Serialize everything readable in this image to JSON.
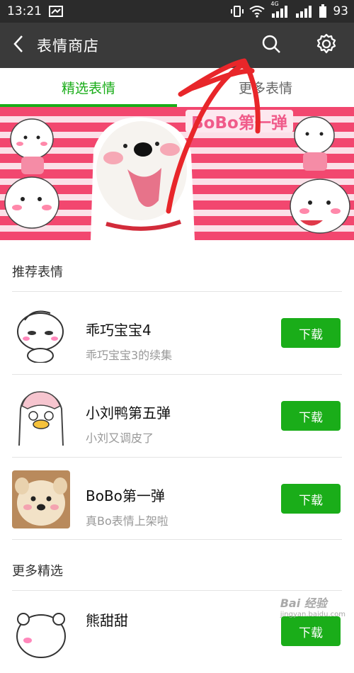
{
  "status_bar": {
    "time": "13:21",
    "battery": "93",
    "network": "4G"
  },
  "header": {
    "title": "表情商店",
    "back_icon": "chevron-left-icon",
    "search_icon": "search-icon",
    "settings_icon": "gear-icon"
  },
  "tabs": [
    {
      "label": "精选表情",
      "active": true
    },
    {
      "label": "更多表情",
      "active": false
    }
  ],
  "banner": {
    "title": "BoBo第一弹"
  },
  "recommended": {
    "section_title": "推荐表情",
    "items": [
      {
        "name": "乖巧宝宝4",
        "desc": "乖巧宝宝3的续集",
        "button": "下载"
      },
      {
        "name": "小刘鸭第五弹",
        "desc": "小刘又调皮了",
        "button": "下载"
      },
      {
        "name": "BoBo第一弹",
        "desc": "真Bo表情上架啦",
        "button": "下载"
      }
    ]
  },
  "more": {
    "section_title": "更多精选",
    "items": [
      {
        "name": "熊甜甜",
        "button": "下载"
      }
    ]
  },
  "watermark": {
    "text": "Bai 经验",
    "sub": "jingyan.baidu.com"
  },
  "colors": {
    "accent_green": "#1aad19",
    "titlebar": "#3a3a3a",
    "statusbar": "#2b2b2b",
    "banner_pink": "#f2476f",
    "annotation_red": "#e8262a"
  }
}
